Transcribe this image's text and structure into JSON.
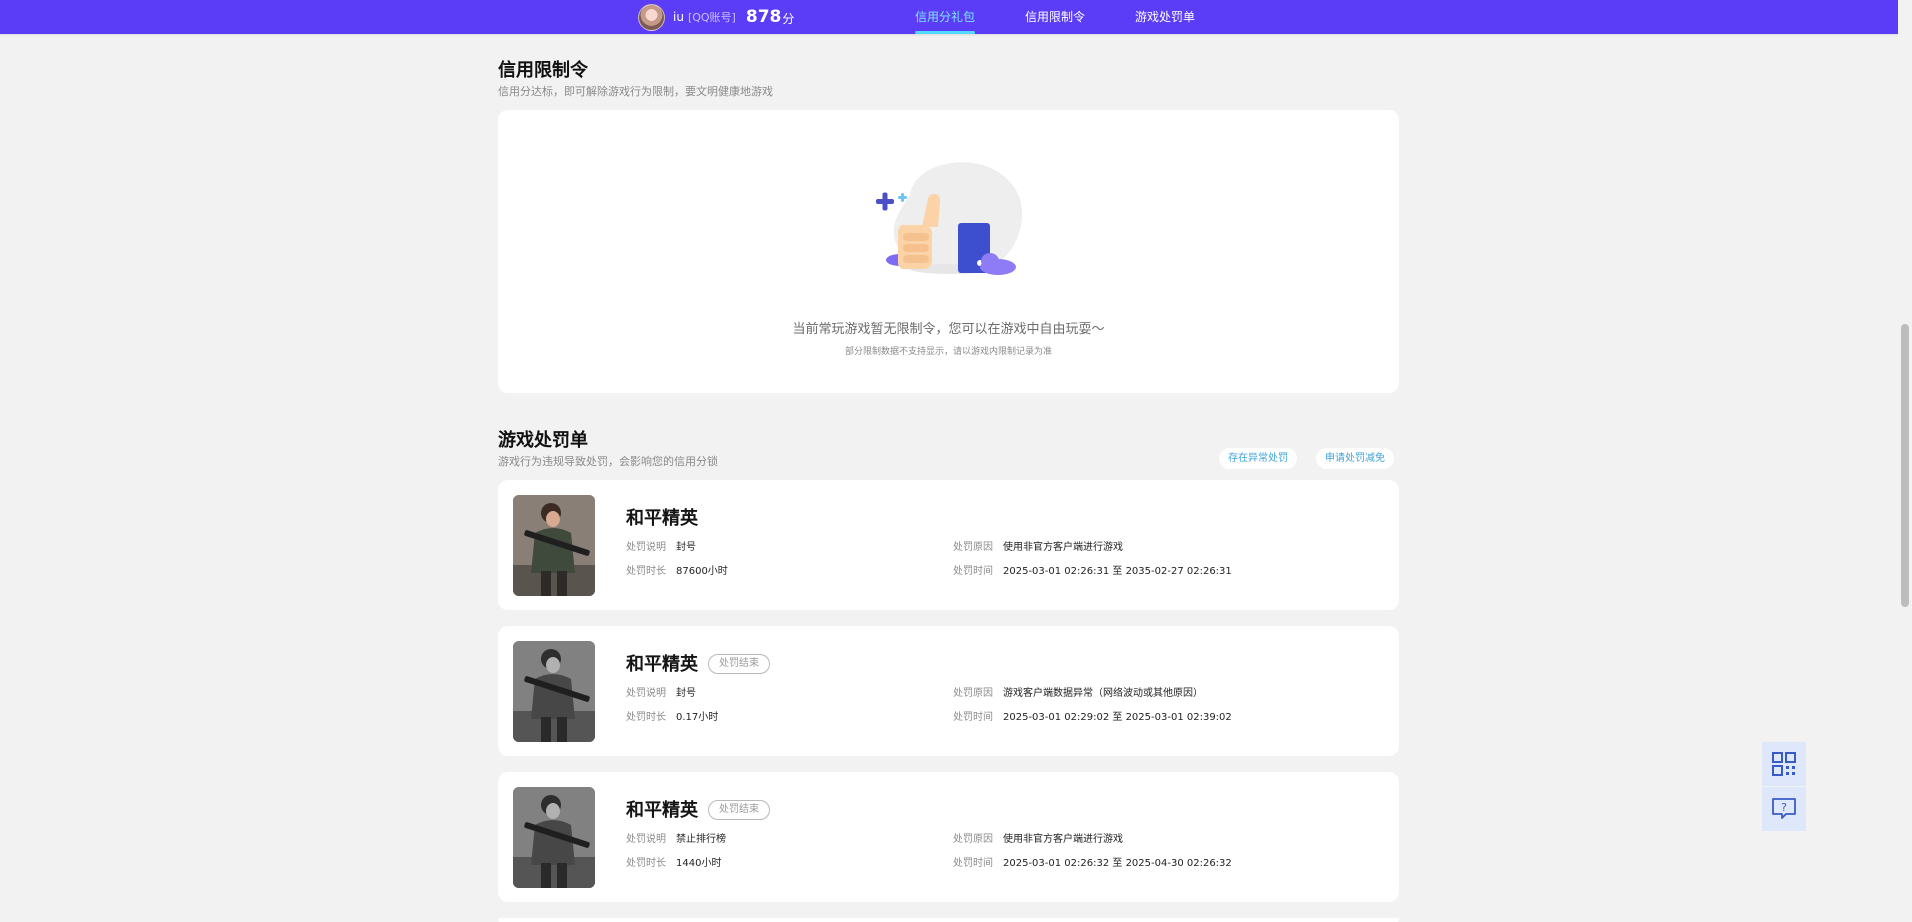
{
  "header": {
    "user_name": "iu",
    "account_type": "[QQ账号]",
    "score": "878",
    "score_unit": "分",
    "tabs": [
      {
        "label": "信用分礼包"
      },
      {
        "label": "信用限制令"
      },
      {
        "label": "游戏处罚单"
      }
    ]
  },
  "restriction": {
    "title": "信用限制令",
    "subtitle": "信用分达标，即可解除游戏行为限制，要文明健康地游戏",
    "empty_text": "当前常玩游戏暂无限制令，您可以在游戏中自由玩耍～",
    "empty_note": "部分限制数据不支持显示，请以游戏内限制记录为准"
  },
  "penalties": {
    "title": "游戏处罚单",
    "subtitle": "游戏行为违规导致处罚，会影响您的信用分锁",
    "actions": [
      "存在异常处罚",
      "申请处罚减免"
    ],
    "labels": {
      "desc": "处罚说明",
      "duration": "处罚时长",
      "reason": "处罚原因",
      "time": "处罚时间"
    },
    "items": [
      {
        "game": "和平精英",
        "badge": "",
        "desc": "封号",
        "duration": "87600小时",
        "reason": "使用非官方客户端进行游戏",
        "time": "2025-03-01 02:26:31 至 2035-02-27 02:26:31"
      },
      {
        "game": "和平精英",
        "badge": "处罚结束",
        "desc": "封号",
        "duration": "0.17小时",
        "reason": "游戏客户端数据异常（网络波动或其他原因）",
        "time": "2025-03-01 02:29:02 至 2025-03-01 02:39:02"
      },
      {
        "game": "和平精英",
        "badge": "处罚结束",
        "desc": "禁止排行榜",
        "duration": "1440小时",
        "reason": "使用非官方客户端进行游戏",
        "time": "2025-03-01 02:26:32 至 2025-04-30 02:26:32"
      }
    ]
  },
  "icons": {
    "float_top": "qr-code-icon",
    "float_bottom": "help-chat-icon"
  }
}
